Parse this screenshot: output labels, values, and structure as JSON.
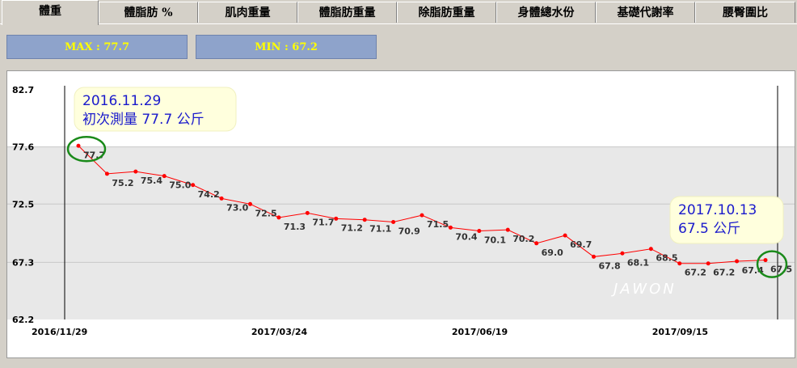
{
  "tabs": [
    {
      "label": "體重",
      "active": true
    },
    {
      "label": "體脂肪 %",
      "active": false
    },
    {
      "label": "肌肉重量",
      "active": false
    },
    {
      "label": "體脂肪重量",
      "active": false
    },
    {
      "label": "除脂肪重量",
      "active": false
    },
    {
      "label": "身體總水份",
      "active": false
    },
    {
      "label": "基礎代謝率",
      "active": false
    },
    {
      "label": "腰臀圍比",
      "active": false
    }
  ],
  "stats": {
    "max_label": "MAX  : 77.7",
    "min_label": "MIN  : 67.2"
  },
  "chart_data": {
    "type": "line",
    "y_ticks": [
      "82.7",
      "77.6",
      "72.5",
      "67.3",
      "62.2"
    ],
    "ylim": [
      62.2,
      82.7
    ],
    "x_tick_labels": [
      "2016/11/29",
      "2017/03/24",
      "2017/06/19",
      "2017/09/15"
    ],
    "series": [
      {
        "values": [
          77.7,
          75.2,
          75.4,
          75.0,
          74.2,
          73.0,
          72.5,
          71.3,
          71.7,
          71.2,
          71.1,
          70.9,
          71.5,
          70.4,
          70.1,
          70.2,
          69.0,
          69.7,
          67.8,
          68.1,
          68.5,
          67.2,
          67.2,
          67.4,
          67.5
        ]
      }
    ],
    "line_color": "#ff0000",
    "band_color": "#e8e8e8",
    "annotations": [
      {
        "line1": "2016.11.29",
        "line2": "初次測量 77.7 公斤"
      },
      {
        "line1": "2017.10.13",
        "line2": "67.5 公斤"
      }
    ],
    "watermark": "JAWON"
  }
}
